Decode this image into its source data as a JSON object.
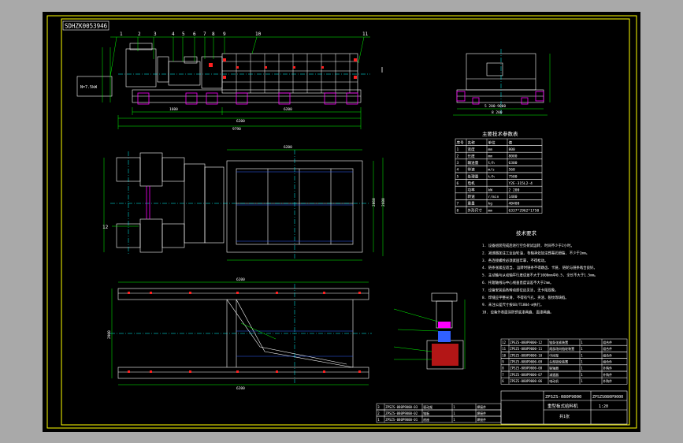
{
  "colors": {
    "outer_bg": "#a9a9a9",
    "canvas": "#000000",
    "frame": "#ffff00",
    "line": "#ffffff",
    "center": "#00ffff",
    "dim": "#00ff00",
    "accent": "#ff00ff",
    "hidden": "#3060ff",
    "red": "#ff2020"
  },
  "drawing": {
    "code_stamp": "SDHZK0053946",
    "part_numbers": [
      "1",
      "2",
      "3",
      "4",
      "5",
      "6",
      "7",
      "8",
      "9",
      "10",
      "11"
    ],
    "callout_12": "12",
    "top_dims": {
      "d1": "1600",
      "d2": "6200",
      "d3": "6200",
      "total": "9790"
    },
    "side_dims": {
      "width": "2060",
      "height": "2600"
    },
    "plan_dim": "6200",
    "section_dim": "2900",
    "motor_label": "N=7.5kW",
    "view_dims": {
      "inner": "5 200-9000",
      "outer": "8 200"
    },
    "params_title": "主要技术参数表",
    "params_header": [
      "序号",
      "名称",
      "单位",
      "值"
    ],
    "params_rows": [
      [
        "1",
        "宽度",
        "mm",
        "800"
      ],
      [
        "2",
        "长度",
        "mm",
        "8000"
      ],
      [
        "3",
        "输送量",
        "t/h",
        "6300"
      ],
      [
        "4",
        "带速",
        "m/s",
        "560"
      ],
      [
        "5",
        "处理量",
        "t/h",
        "7500"
      ],
      [
        "6",
        "电机",
        "",
        "Y2E-315L2-4"
      ],
      [
        "",
        "功率",
        "kW",
        "2 200"
      ],
      [
        "",
        "转速",
        "r/min",
        "1480"
      ],
      [
        "7",
        "重量",
        "kg",
        "40400"
      ],
      [
        "8",
        "外形尺寸",
        "mm",
        "6337*2962*1750"
      ]
    ],
    "tech_title": "技术要求",
    "tech_items": [
      "1. 设备组装完成后进行空负荷试运转, 时间不少于2小时。",
      "2. 减速器加注工业齿轮油, 各轴承处加注锂基润滑脂, 不少于2mm。",
      "3. 各连接螺栓必须紧固牢靠, 不得松动。",
      "4. 链条张紧应适当, 运转时链条不得跳齿、卡链, 链轮与链条啮合良好。",
      "5. 主动轴与从动轴平行度误差不大于1000mm中0.5, 全长不大于1.5mm。",
      "6. 托辊轴线与中心线垂直度误差不大于2mm。",
      "7. 设备安装后各转动部位应灵活, 无卡阻现象。",
      "8. 焊缝应平整光滑, 不得有气孔、夹渣、裂纹等缺陷。",
      "9. 未注公差尺寸按GB/T1804-m执行。",
      "10. 设备外表面涂防锈底漆两遍, 面漆两遍。"
    ],
    "bom_rows": [
      [
        "12",
        "ZPSZS-080P9000-12",
        "链条张紧装置",
        "1",
        "组合件"
      ],
      [
        "11",
        "ZPSZS-080P9000-11",
        "尾部改向链轮装置",
        "1",
        "组合件"
      ],
      [
        "10",
        "ZPSZS-080P9000-10",
        "中间架",
        "1",
        "组合件"
      ],
      [
        "9",
        "ZPSZS-080P9000-09",
        "头部链轮装置",
        "1",
        "组合件"
      ],
      [
        "8",
        "ZPSZS-080P9000-08",
        "联轴器",
        "1",
        "外购件"
      ],
      [
        "7",
        "ZPSZS-080P9000-07",
        "减速器",
        "1",
        "外购件"
      ],
      [
        "6",
        "ZPSZS-080P9000-06",
        "电动机",
        "1",
        "外购件"
      ]
    ],
    "bom_bottom_rows": [
      [
        "3",
        "ZPSZS-080P9000-03",
        "驱动架",
        "1",
        "焊接件"
      ],
      [
        "2",
        "ZPSZS-080P9000-02",
        "链板",
        "1",
        "焊接件"
      ],
      [
        "1",
        "ZPSZS-080P9000-01",
        "底座",
        "1",
        "焊接件"
      ]
    ],
    "title_block": {
      "model": "ZPSZS-080P9000",
      "name": "重型板式给料机",
      "drawing_no": "ZPSZS080P9000",
      "scale": "1:20",
      "sheet": "共1张"
    }
  }
}
